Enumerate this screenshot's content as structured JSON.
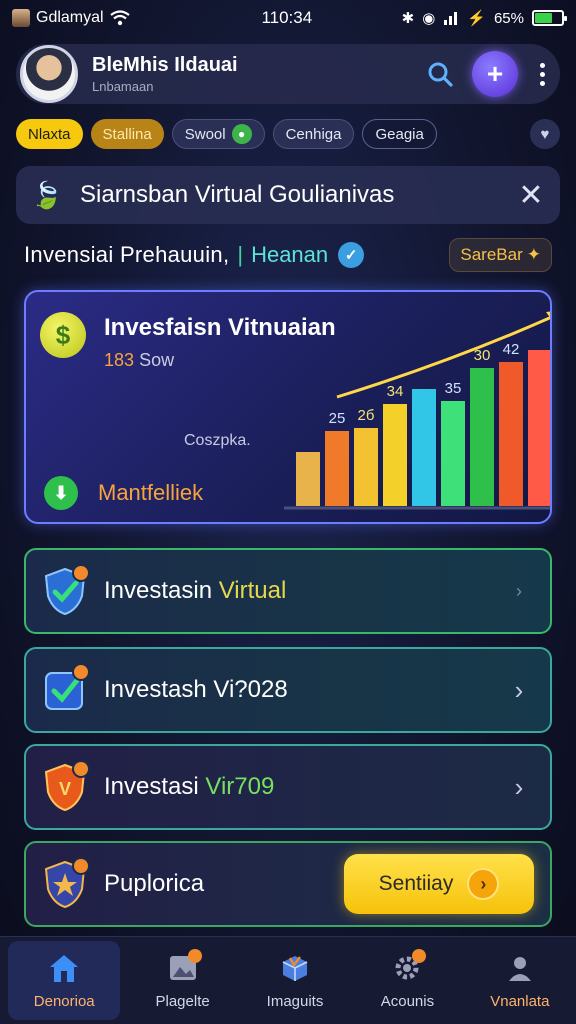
{
  "status_bar": {
    "carrier": "Gdlamyal",
    "time": "110:34",
    "battery_pct": "65%",
    "battery_level": 0.65
  },
  "header": {
    "name": "BleMhis Ildauai",
    "subtitle": "Lnbamaan"
  },
  "chips": [
    "Nlaxta",
    "Stallina",
    "Swool",
    "Cenhiga",
    "Geagia"
  ],
  "banner": {
    "title": "Siarnsban Virtual Goulianivas"
  },
  "section": {
    "title": "Invensiai  Prehauuin,",
    "separator": "|",
    "link": "Heanan",
    "see_all": "SareBar"
  },
  "hero": {
    "title": "Invesfaisn Vitnuaian",
    "value_num": "183",
    "value_text": "Sow",
    "small_label": "Coszpka.",
    "footer": "Mantfelliek"
  },
  "chart_data": {
    "type": "bar",
    "categories": [
      "1",
      "2",
      "3",
      "4",
      "5",
      "6",
      "7",
      "8",
      "9"
    ],
    "values": [
      18,
      25,
      26,
      34,
      39,
      35,
      46,
      48,
      52
    ],
    "data_labels": [
      "",
      "25",
      "2б",
      "34",
      "",
      "35",
      "30",
      "42",
      ""
    ],
    "colors": [
      "#e8b34a",
      "#ef7a2a",
      "#f2c230",
      "#f4d02a",
      "#31c6e8",
      "#3ee07a",
      "#2fbf4b",
      "#f0592a",
      "#ff5a47"
    ],
    "trend": "up"
  },
  "list": [
    {
      "label_plain": "Investasin ",
      "label_accent": "Virtual",
      "accent": "yellow"
    },
    {
      "label_plain": "Investash Vi?028",
      "label_accent": "",
      "accent": "none"
    },
    {
      "label_plain": "Investasi ",
      "label_accent": "Vir709",
      "accent": "green"
    },
    {
      "label_plain": "Puplorica",
      "label_accent": "",
      "accent": "none",
      "cta": "Sentiiay"
    }
  ],
  "bottom_nav": [
    {
      "label": "Denorioa",
      "icon": "home-icon"
    },
    {
      "label": "Plagelte",
      "icon": "gallery-icon"
    },
    {
      "label": "Imaguits",
      "icon": "box-icon"
    },
    {
      "label": "Acounis",
      "icon": "gear-icon"
    },
    {
      "label": "Vnanlata",
      "icon": "profile-icon"
    }
  ]
}
